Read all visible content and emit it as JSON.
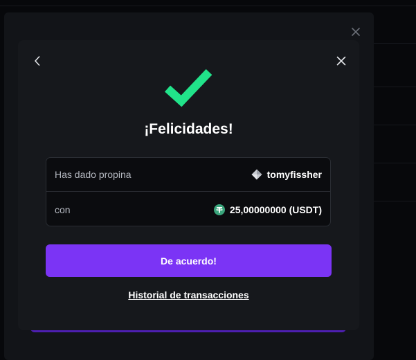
{
  "modal": {
    "title": "¡Felicidades!",
    "rows": [
      {
        "label": "Has dado propina",
        "value": "tomyfissher",
        "icon": "user-diamond-icon"
      },
      {
        "label": "con",
        "value": "25,00000000 (USDT)",
        "icon": "tether-icon"
      }
    ],
    "confirm_label": "De acuerdo!",
    "history_link": "Historial de transacciones"
  },
  "colors": {
    "accent": "#7b34f5",
    "success": "#21e38a",
    "tether": "#3aa57c",
    "modal_bg": "#16181c"
  }
}
